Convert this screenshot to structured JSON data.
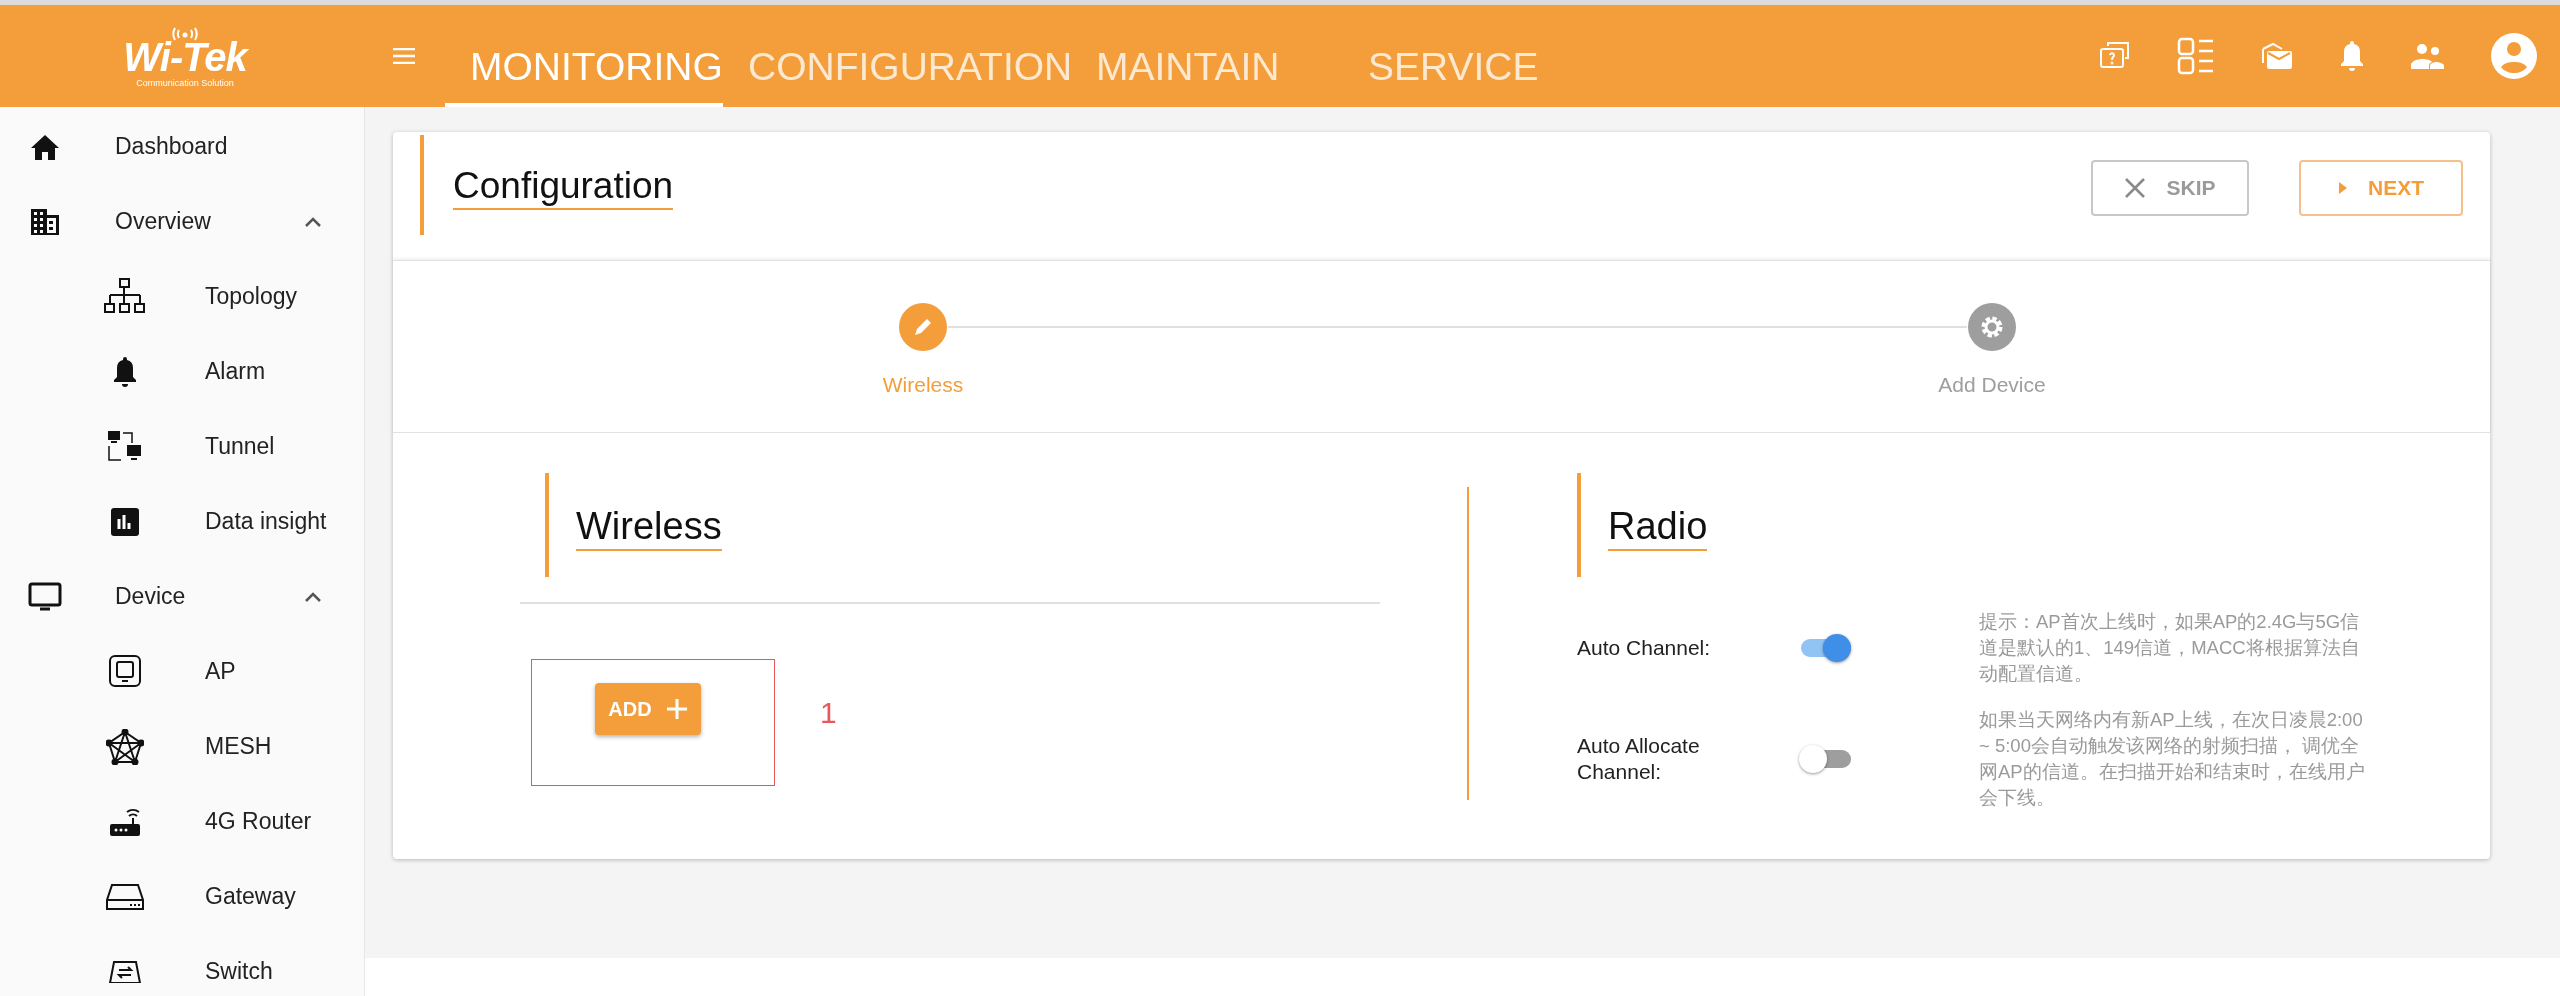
{
  "header": {
    "logo": {
      "name": "Wi-Tek",
      "tagline": "Communication Solution"
    },
    "tabs": [
      {
        "label": "MONITORING",
        "selected": true
      },
      {
        "label": "CONFIGURATION",
        "selected": false
      },
      {
        "label": "MAINTAIN",
        "selected": false
      },
      {
        "label": "SERVICE",
        "selected": false
      }
    ]
  },
  "sidebar": {
    "items": [
      {
        "label": "Dashboard"
      },
      {
        "label": "Overview",
        "expanded": true,
        "children": [
          {
            "label": "Topology"
          },
          {
            "label": "Alarm"
          },
          {
            "label": "Tunnel"
          },
          {
            "label": "Data insight"
          }
        ]
      },
      {
        "label": "Device",
        "expanded": true,
        "children": [
          {
            "label": "AP"
          },
          {
            "label": "MESH"
          },
          {
            "label": "4G Router"
          },
          {
            "label": "Gateway"
          },
          {
            "label": "Switch"
          }
        ]
      }
    ]
  },
  "page": {
    "title": "Configuration",
    "buttons": [
      {
        "kind": "skip",
        "label": "SKIP"
      },
      {
        "kind": "next",
        "label": "NEXT"
      }
    ],
    "steps": [
      {
        "label": "Wireless",
        "selected": true
      },
      {
        "label": "Add Device",
        "selected": false
      }
    ],
    "wireless": {
      "title": "Wireless",
      "add_button": "ADD",
      "annotation": "1"
    },
    "radio": {
      "title": "Radio",
      "settings": [
        {
          "label": "Auto Channel:",
          "on": true,
          "hint": "提示：AP首次上线时，如果AP的2.4G与5G信道是默认的1、149信道，MACC将根据算法自动配置信道。"
        },
        {
          "label": "Auto Allocate Channel:",
          "on": false,
          "hint": "如果当天网络内有新AP上线，在次日凌晨2:00 ~ 5:00会自动触发该网络的射频扫描， 调优全网AP的信道。在扫描开始和结束时，在线用户会下线。"
        }
      ]
    }
  }
}
